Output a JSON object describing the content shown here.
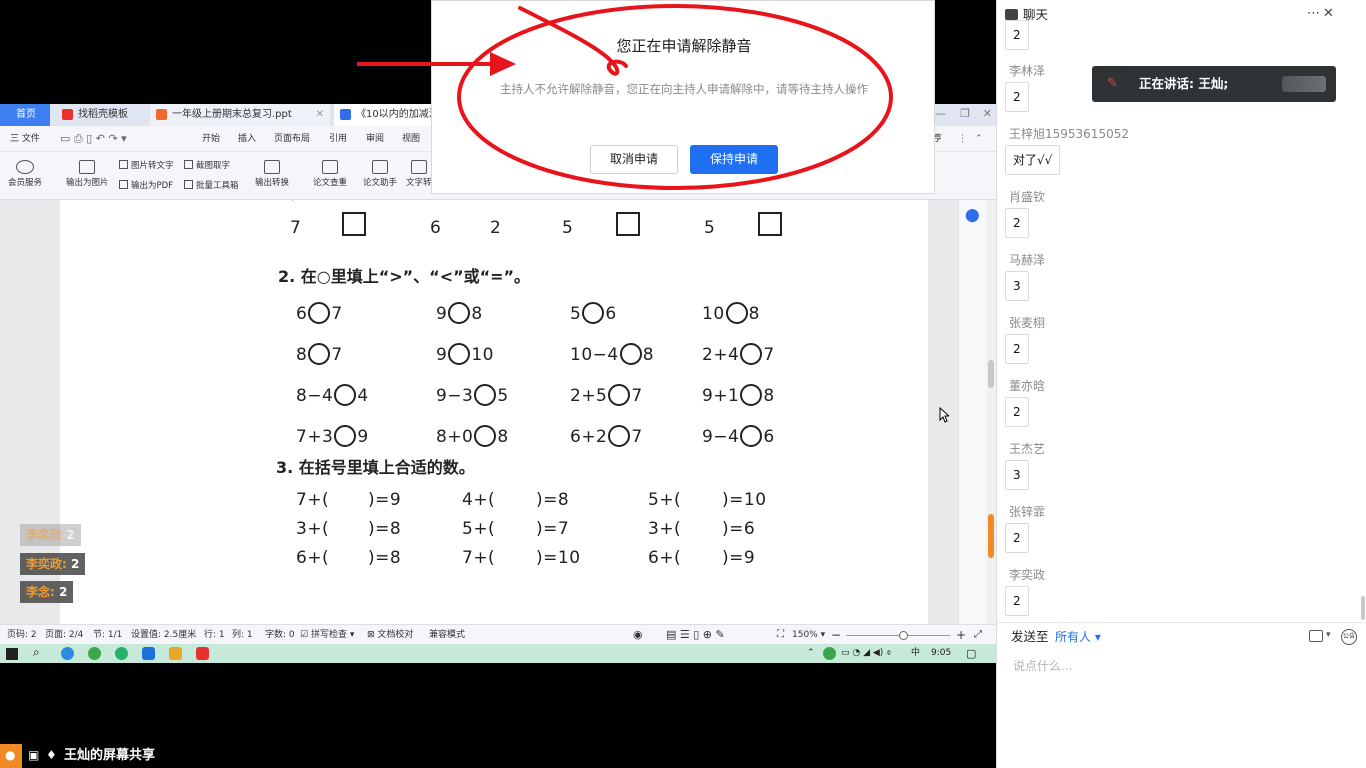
{
  "wps": {
    "tabs": [
      {
        "label": "首页"
      },
      {
        "label": "找稻壳模板"
      },
      {
        "label": "一年级上册期末总复习.ppt"
      },
      {
        "label": "《10以内的加减法》"
      }
    ],
    "menu": [
      "三 文件",
      "开始",
      "插入",
      "页面布局",
      "引用",
      "审阅",
      "视图",
      "亨"
    ],
    "ribbon": {
      "member": "会员服务",
      "to_image": "输出为图片",
      "image_to_text": "图片转文字",
      "to_pdf": "输出为PDF",
      "screenshot_text": "截图取字",
      "batch_tools": "批量工具箱",
      "export_convert": "输出转换",
      "plagiarism": "论文查重",
      "paper_assist": "论文助手",
      "text_tool": "文字转"
    },
    "doc": {
      "top_numbers": [
        "7",
        "6",
        "2",
        "5",
        "5"
      ],
      "sec2_title": "2. 在○里填上“>”、“<”或“=”。",
      "sec2_rows": [
        [
          [
            "6",
            "7"
          ],
          [
            "9",
            "8"
          ],
          [
            "5",
            "6"
          ],
          [
            "10",
            "8"
          ]
        ],
        [
          [
            "8",
            "7"
          ],
          [
            "9",
            "10"
          ],
          [
            "10−4",
            "8"
          ],
          [
            "2+4",
            "7"
          ]
        ],
        [
          [
            "8−4",
            "4"
          ],
          [
            "9−3",
            "5"
          ],
          [
            "2+5",
            "7"
          ],
          [
            "9+1",
            "8"
          ]
        ],
        [
          [
            "7+3",
            "9"
          ],
          [
            "8+0",
            "8"
          ],
          [
            "6+2",
            "7"
          ],
          [
            "9−4",
            "6"
          ]
        ]
      ],
      "sec3_title": "3. 在括号里填上合适的数。",
      "sec3_rows": [
        [
          "7+(",
          ")=9",
          "4+(",
          ")=8",
          "5+(",
          ")=10"
        ],
        [
          "3+(",
          ")=8",
          "5+(",
          ")=7",
          "3+(",
          ")=6"
        ],
        [
          "6+(",
          ")=8",
          "7+(",
          ")=10",
          "6+(",
          ")=9"
        ]
      ]
    },
    "status": {
      "page_no": "页码: 2",
      "page_of": "页面: 2/4",
      "section": "节: 1/1",
      "set_value": "设置值: 2.5厘米",
      "row": "行: 1",
      "col": "列: 1",
      "words": "字数: 0",
      "spell": "拼写检查",
      "proof": "文档校对",
      "compat": "兼容模式",
      "zoom": "150%"
    },
    "taskbar_time": "9:05",
    "taskbar_ime": "中"
  },
  "dialog": {
    "title": "您正在申请解除静音",
    "message": "主持人不允许解除静音，您正在向主持人申请解除中，请等待主持人操作",
    "cancel": "取消申请",
    "keep": "保持申请"
  },
  "overlay_ranks": [
    {
      "name": "李奕政",
      "score": "2",
      "faded": true
    },
    {
      "name": "李奕政:",
      "score": "2",
      "faded": false
    },
    {
      "name": "李念:",
      "score": "2",
      "faded": false
    }
  ],
  "share": {
    "label": "王灿的屏幕共享"
  },
  "speaking": {
    "label": "正在讲话: 王灿;"
  },
  "chat": {
    "title": "聊天",
    "first_bubble": "2",
    "messages": [
      {
        "name": "李林泽",
        "text": "2"
      },
      {
        "name": "王梓旭15953615052",
        "text": "对了√√"
      },
      {
        "name": "肖盛钦",
        "text": "2"
      },
      {
        "name": "马赫泽",
        "text": "3"
      },
      {
        "name": "张麦栩",
        "text": "  2"
      },
      {
        "name": "董亦晗",
        "text": "2"
      },
      {
        "name": "王杰艺",
        "text": "3"
      },
      {
        "name": "张锌霏",
        "text": "2"
      },
      {
        "name": "李奕政",
        "text": "2"
      }
    ],
    "send_to": "发送至",
    "target": "所有人",
    "input_placeholder": "说点什么...",
    "public_badge": "公告"
  },
  "colors": {
    "accent": "#1f6ff2",
    "annotation": "#e8141b",
    "taskbar": "#c7e9d9",
    "rank_name": "#f39a2b"
  }
}
